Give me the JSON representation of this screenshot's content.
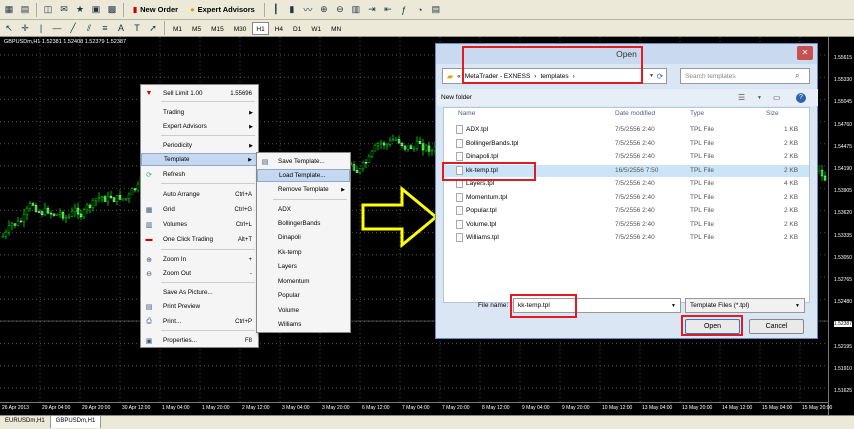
{
  "toolbar": {
    "new_order": "New Order",
    "expert_advisors": "Expert Advisors",
    "timeframes": [
      "M1",
      "M5",
      "M15",
      "M30",
      "H1",
      "H4",
      "D1",
      "W1",
      "MN"
    ],
    "active_timeframe": "H1"
  },
  "chart": {
    "title": "GBPUSDm,H1  1.52381 1.52408 1.52379 1.52387",
    "prices": [
      "1.55615",
      "1.55330",
      "1.55045",
      "1.54760",
      "1.54475",
      "1.54190",
      "1.53905",
      "1.53620",
      "1.53335",
      "1.53050",
      "1.52765",
      "1.52480",
      "1.52387",
      "1.52195",
      "1.51910",
      "1.51625"
    ],
    "current_price": "1.52387",
    "times": [
      "26 Apr 2013",
      "29 Apr 04:00",
      "29 Apr 20:00",
      "30 Apr 12:00",
      "1 May 04:00",
      "1 May 20:00",
      "2 May 12:00",
      "3 May 04:00",
      "3 May 20:00",
      "6 May 12:00",
      "7 May 04:00",
      "7 May 20:00",
      "8 May 12:00",
      "9 May 04:00",
      "9 May 20:00",
      "10 May 12:00",
      "13 May 04:00",
      "13 May 20:00",
      "14 May 12:00",
      "15 May 04:00",
      "15 May 20:00"
    ],
    "bull_color": "#00e600",
    "bear_color": "#ffffff"
  },
  "tabs": [
    "EURUSDm,H1",
    "GBPUSDm,H1"
  ],
  "active_tab": "GBPUSDm,H1",
  "context_menu": {
    "sell_limit": {
      "label": "Sell Limit 1.00",
      "value": "1.55696"
    },
    "trading": "Trading",
    "expert_advisors": "Expert Advisors",
    "periodicity": "Periodicity",
    "template": "Template",
    "refresh": "Refresh",
    "auto_arrange": {
      "label": "Auto Arrange",
      "shortcut": "Ctrl+A"
    },
    "grid": {
      "label": "Grid",
      "shortcut": "Ctrl+G"
    },
    "volumes": {
      "label": "Volumes",
      "shortcut": "Ctrl+L"
    },
    "one_click": {
      "label": "One Click Trading",
      "shortcut": "Alt+T"
    },
    "zoom_in": {
      "label": "Zoom In",
      "shortcut": "+"
    },
    "zoom_out": {
      "label": "Zoom Out",
      "shortcut": "-"
    },
    "save_as_picture": "Save As Picture...",
    "print_preview": "Print Preview",
    "print": {
      "label": "Print...",
      "shortcut": "Ctrl+P"
    },
    "properties": {
      "label": "Properties...",
      "shortcut": "F8"
    }
  },
  "template_menu": {
    "save": "Save Template...",
    "load": "Load Template...",
    "remove": "Remove Template",
    "items": [
      "ADX",
      "BollingerBands",
      "Dinapoli",
      "Kk-temp",
      "Layers",
      "Momentum",
      "Popular",
      "Volume",
      "Williams"
    ]
  },
  "dialog": {
    "title": "Open",
    "path": [
      "MetaTrader - EXNESS",
      "templates"
    ],
    "search_placeholder": "Search templates",
    "new_folder": "New folder",
    "columns": {
      "name": "Name",
      "date": "Date modified",
      "type": "Type",
      "size": "Size"
    },
    "files": [
      {
        "name": "ADX.tpl",
        "date": "7/5/2556 2:40",
        "type": "TPL File",
        "size": "1 KB"
      },
      {
        "name": "BollingerBands.tpl",
        "date": "7/5/2556 2:40",
        "type": "TPL File",
        "size": "2 KB"
      },
      {
        "name": "Dinapoli.tpl",
        "date": "7/5/2556 2:40",
        "type": "TPL File",
        "size": "2 KB"
      },
      {
        "name": "kk-temp.tpl",
        "date": "16/5/2556 7:50",
        "type": "TPL File",
        "size": "2 KB"
      },
      {
        "name": "Layers.tpl",
        "date": "7/5/2556 2:40",
        "type": "TPL File",
        "size": "4 KB"
      },
      {
        "name": "Momentum.tpl",
        "date": "7/5/2556 2:40",
        "type": "TPL File",
        "size": "2 KB"
      },
      {
        "name": "Popular.tpl",
        "date": "7/5/2556 2:40",
        "type": "TPL File",
        "size": "2 KB"
      },
      {
        "name": "Volume.tpl",
        "date": "7/5/2556 2:40",
        "type": "TPL File",
        "size": "2 KB"
      },
      {
        "name": "Williams.tpl",
        "date": "7/5/2556 2:40",
        "type": "TPL File",
        "size": "2 KB"
      }
    ],
    "selected_file": "kk-temp.tpl",
    "filename_label": "File name:",
    "filename_value": "kk-temp.tpl",
    "filetype": "Template Files (*.tpl)",
    "open_label": "Open",
    "cancel_label": "Cancel"
  },
  "highlight_color": "#e01c23",
  "arrow_color": "#ffff00"
}
